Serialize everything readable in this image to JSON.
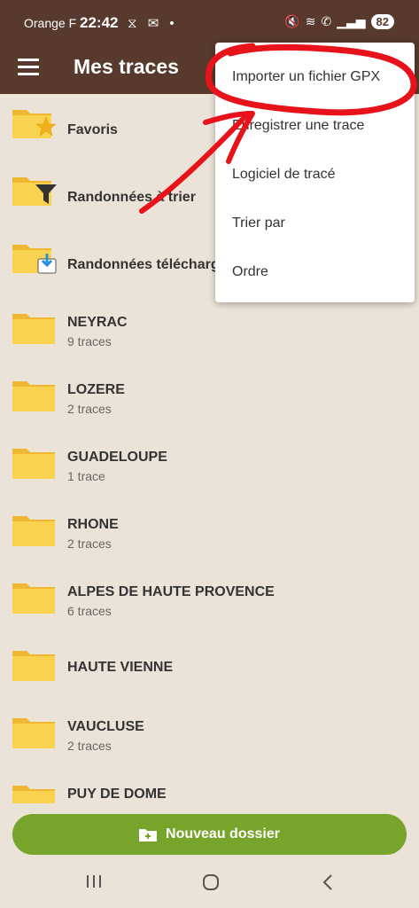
{
  "status_bar": {
    "carrier": "Orange F",
    "time": "22:42",
    "battery": "82"
  },
  "app_bar": {
    "title": "Mes traces"
  },
  "folders": [
    {
      "name": "Favoris",
      "count": "",
      "icon": "folder-star-icon"
    },
    {
      "name": "Randonnées à trier",
      "count": "",
      "icon": "folder-filter-icon"
    },
    {
      "name": "Randonnées téléchargées",
      "count": "",
      "icon": "folder-download-icon"
    },
    {
      "name": "NEYRAC",
      "count": "9 traces",
      "icon": "folder-icon"
    },
    {
      "name": "LOZERE",
      "count": "2 traces",
      "icon": "folder-icon"
    },
    {
      "name": "GUADELOUPE",
      "count": "1 trace",
      "icon": "folder-icon"
    },
    {
      "name": "RHONE",
      "count": "2 traces",
      "icon": "folder-icon"
    },
    {
      "name": "ALPES DE HAUTE PROVENCE",
      "count": "6 traces",
      "icon": "folder-icon"
    },
    {
      "name": "HAUTE VIENNE",
      "count": "",
      "icon": "folder-icon"
    },
    {
      "name": "VAUCLUSE",
      "count": "2 traces",
      "icon": "folder-icon"
    },
    {
      "name": "PUY DE DOME",
      "count": "",
      "icon": "folder-icon"
    }
  ],
  "menu": {
    "items": [
      "Importer un fichier GPX",
      "Enregistrer une trace",
      "Logiciel de tracé",
      "Trier par",
      "Ordre"
    ]
  },
  "bottom": {
    "new_folder_label": "Nouveau dossier"
  },
  "colors": {
    "app_bar": "#57392d",
    "background": "#ebe3d7",
    "accent_button": "#77a42a",
    "folder": "#f5c842",
    "annotation": "#e8121a"
  }
}
